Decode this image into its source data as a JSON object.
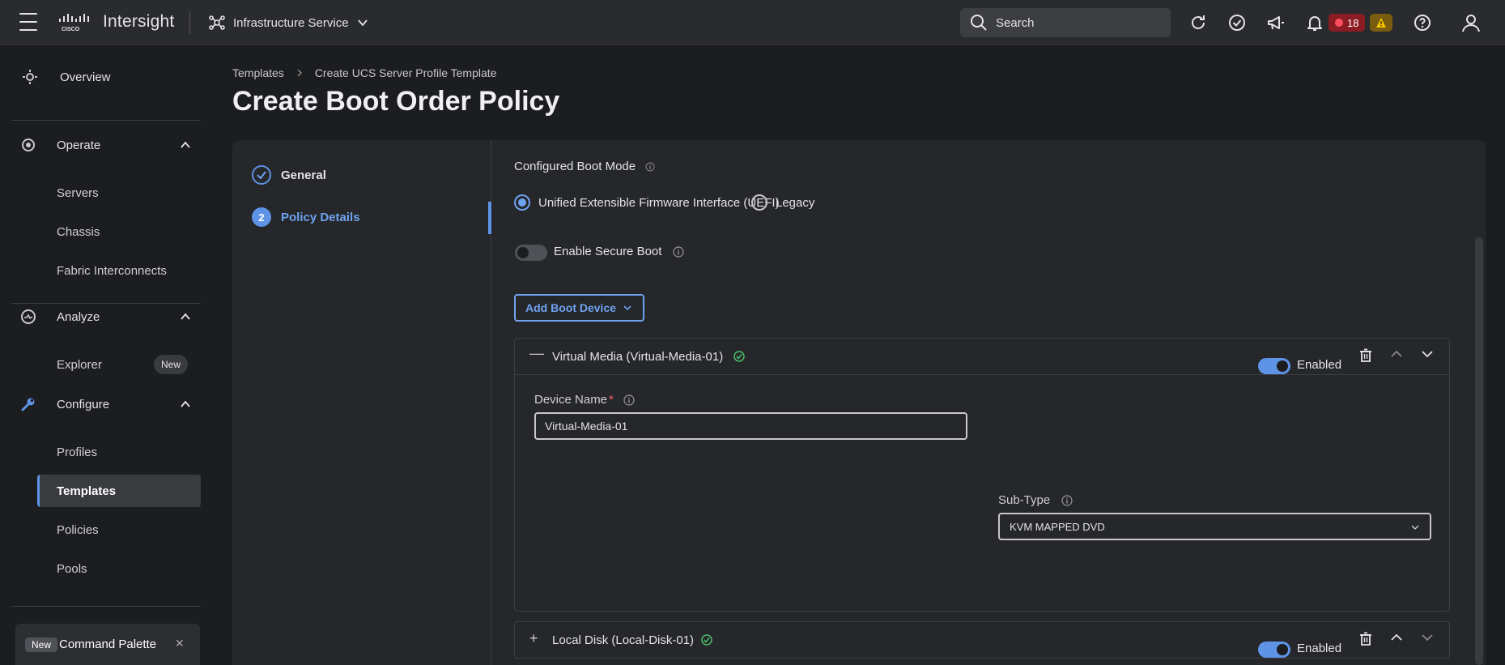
{
  "app": {
    "brand": "Intersight",
    "service": "Infrastructure Service",
    "search_placeholder": "Search",
    "alerts_count": "18"
  },
  "sidebar": {
    "overview": "Overview",
    "operate": {
      "label": "Operate",
      "items": [
        "Servers",
        "Chassis",
        "Fabric Interconnects"
      ]
    },
    "analyze": {
      "label": "Analyze",
      "items": [
        "Explorer"
      ],
      "explorer_badge": "New"
    },
    "configure": {
      "label": "Configure",
      "items": [
        "Profiles",
        "Templates",
        "Policies",
        "Pools"
      ],
      "active": "Templates"
    },
    "command_palette": {
      "tag": "New",
      "label": "Command Palette"
    }
  },
  "breadcrumb": [
    "Templates",
    "Create UCS Server Profile Template"
  ],
  "page_title": "Create Boot Order Policy",
  "steps": [
    {
      "label": "General",
      "state": "done"
    },
    {
      "label": "Policy Details",
      "number": "2",
      "state": "active"
    }
  ],
  "form": {
    "boot_mode_label": "Configured Boot Mode",
    "boot_modes": [
      "Unified Extensible Firmware Interface (UEFI)",
      "Legacy"
    ],
    "selected_boot_mode": "Unified Extensible Firmware Interface (UEFI)",
    "secure_boot_label": "Enable Secure Boot",
    "secure_boot_enabled": false,
    "add_boot_device": "Add Boot Device"
  },
  "devices": [
    {
      "title": "Virtual Media (Virtual-Media-01)",
      "expanded": true,
      "enabled_label": "Enabled",
      "enabled": true,
      "device_name_label": "Device Name",
      "device_name_value": "Virtual-Media-01",
      "subtype_label": "Sub-Type",
      "subtype_value": "KVM MAPPED DVD"
    },
    {
      "title": "Local Disk (Local-Disk-01)",
      "expanded": false,
      "enabled_label": "Enabled",
      "enabled": true
    }
  ],
  "colors": {
    "accent": "#5e93e6",
    "success": "#4cbf6b",
    "critical": "#8c1c24",
    "warning": "#7a5c10"
  }
}
